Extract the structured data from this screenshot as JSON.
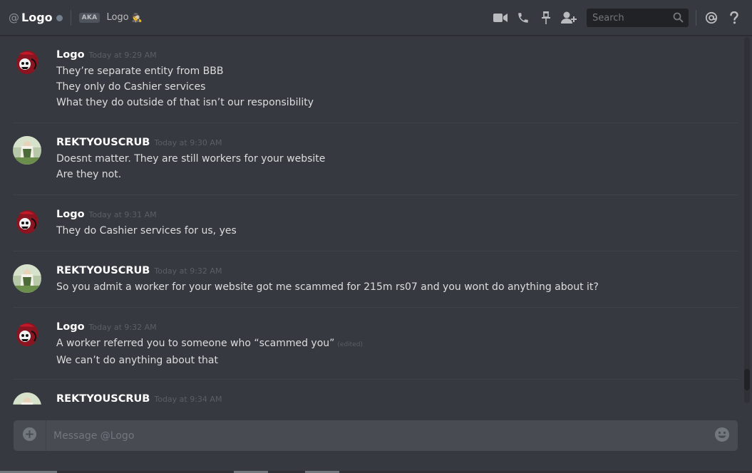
{
  "header": {
    "at_symbol": "@",
    "dm_name": "Logo",
    "aka_label": "AKA",
    "nickname": "Logo",
    "nickname_emoji": "🕵",
    "search_placeholder": "Search",
    "icons": [
      "video-call-icon",
      "voice-call-icon",
      "pinned-messages-icon",
      "add-friend-icon",
      "search-icon",
      "mentions-icon",
      "help-icon"
    ]
  },
  "messages": [
    {
      "author": "Logo",
      "timestamp": "Today at 9:29 AM",
      "avatar": "logo-avatar",
      "lines": [
        "They’re separate entity from BBB",
        "They only do Cashier services",
        "What they do outside of that isn’t our responsibility"
      ]
    },
    {
      "author": "REKTYOUSCRUB",
      "timestamp": "Today at 9:30 AM",
      "avatar": "rekt-avatar",
      "lines": [
        "Doesnt matter. They are still workers for your website",
        "Are they not."
      ]
    },
    {
      "author": "Logo",
      "timestamp": "Today at 9:31 AM",
      "avatar": "logo-avatar",
      "lines": [
        "They do Cashier services for us, yes"
      ]
    },
    {
      "author": "REKTYOUSCRUB",
      "timestamp": "Today at 9:32 AM",
      "avatar": "rekt-avatar",
      "lines": [
        "So you admit a worker for your website got me scammed for 215m rs07 and you wont do anything about it?"
      ]
    },
    {
      "author": "Logo",
      "timestamp": "Today at 9:32 AM",
      "avatar": "logo-avatar",
      "lines": [
        "A worker referred you to someone who “scammed you”",
        "We can’t do anything about that"
      ],
      "edited_label": "(edited)"
    },
    {
      "author": "REKTYOUSCRUB",
      "timestamp": "Today at 9:34 AM",
      "avatar": "rekt-avatar",
      "lines": []
    }
  ],
  "composer": {
    "placeholder": "Message @Logo"
  },
  "colors": {
    "background": "#36393f",
    "header_border": "#2a2c31",
    "input_bg": "#484c52",
    "search_bg": "#202225",
    "username": "#ffffff",
    "timestamp": "#5b5f66"
  }
}
